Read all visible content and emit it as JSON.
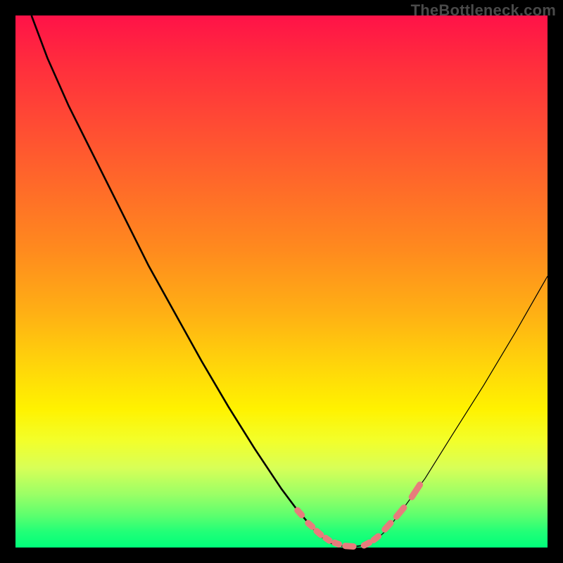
{
  "attribution": "TheBottleneck.com",
  "chart_data": {
    "type": "line",
    "title": "",
    "xlabel": "",
    "ylabel": "",
    "xlim": [
      0,
      100
    ],
    "ylim": [
      0,
      100
    ],
    "series": [
      {
        "name": "curve-left",
        "x": [
          3,
          6,
          10,
          15,
          20,
          25,
          30,
          35,
          40,
          45,
          50,
          53,
          56,
          58.5
        ],
        "values": [
          100,
          92,
          83,
          73,
          63,
          53,
          44,
          35,
          26.5,
          18.5,
          11,
          7,
          3.5,
          1.2
        ]
      },
      {
        "name": "curve-bottom",
        "x": [
          58.5,
          60,
          62,
          64,
          66,
          67.5
        ],
        "values": [
          1.2,
          0.5,
          0.2,
          0.2,
          0.5,
          1.2
        ]
      },
      {
        "name": "curve-right",
        "x": [
          67.5,
          70,
          73,
          77,
          82,
          88,
          94,
          100
        ],
        "values": [
          1.2,
          3.5,
          7.5,
          13,
          21,
          30.5,
          40.5,
          51
        ]
      },
      {
        "name": "dashes-left",
        "x": [
          53,
          53.8,
          55,
          55.8,
          56.6,
          57.4,
          58.3,
          59,
          60,
          60.8,
          62,
          63.5
        ],
        "values": [
          7,
          6.1,
          4.6,
          3.9,
          3.1,
          2.4,
          1.8,
          1.3,
          0.9,
          0.6,
          0.3,
          0.2
        ]
      },
      {
        "name": "dashes-right",
        "x": [
          65.5,
          66.5,
          67.3,
          68.2,
          69.4,
          70.5,
          71.6,
          73,
          74.5,
          76
        ],
        "values": [
          0.4,
          0.9,
          1.4,
          2.1,
          3.4,
          4.6,
          5.8,
          7.5,
          9.5,
          11.8
        ]
      }
    ],
    "style": {
      "curve_color": "#000000",
      "curve_width_left": 2.6,
      "curve_width_right": 1.2,
      "dash_color": "#e77c7c",
      "dash_width": 9
    }
  }
}
